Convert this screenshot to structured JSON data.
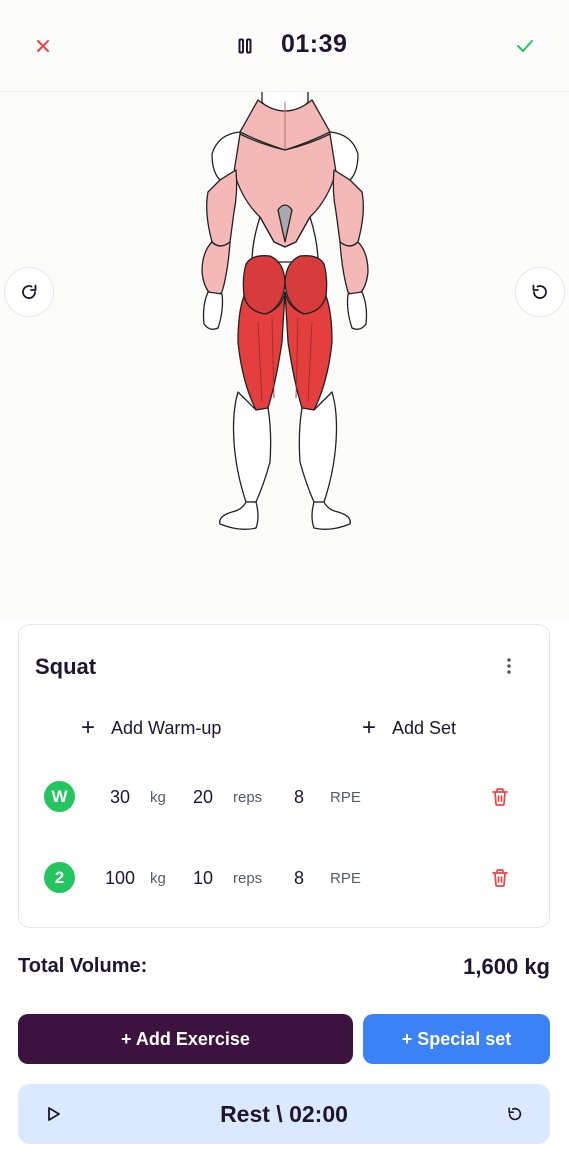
{
  "header": {
    "timer": "01:39",
    "close_icon": "close-icon",
    "pause_icon": "pause-icon",
    "check_icon": "check-icon",
    "colors": {
      "close": "#ef4444",
      "check": "#22c55e"
    }
  },
  "muscle_map": {
    "view": "back",
    "highlighted_primary": [
      "hamstrings",
      "glutes"
    ],
    "highlighted_secondary": [
      "back",
      "arms"
    ],
    "colors": {
      "primary": "#e53e3e",
      "secondary": "#f4b8b6"
    },
    "rotate_left_icon": "rotate-cw-icon",
    "rotate_right_icon": "rotate-ccw-icon"
  },
  "exercise": {
    "name": "Squat",
    "menu_icon": "more-vertical-icon",
    "add_warmup_label": "Add Warm-up",
    "add_set_label": "Add Set",
    "plus": "+",
    "sets": [
      {
        "badge": "W",
        "weight": "30",
        "weight_unit": "kg",
        "reps": "20",
        "reps_unit": "reps",
        "rpe": "8",
        "rpe_unit": "RPE"
      },
      {
        "badge": "2",
        "weight": "100",
        "weight_unit": "kg",
        "reps": "10",
        "reps_unit": "reps",
        "rpe": "8",
        "rpe_unit": "RPE"
      }
    ]
  },
  "summary": {
    "volume_label": "Total Volume:",
    "volume_value": "1,600 kg"
  },
  "actions": {
    "add_exercise": "+ Add Exercise",
    "special_set": "+ Special set",
    "colors": {
      "add_exercise": "#3b133e",
      "special_set": "#3b82f6"
    }
  },
  "rest": {
    "label": "Rest \\ 02:00",
    "play_icon": "play-icon",
    "reset_icon": "reset-icon"
  }
}
